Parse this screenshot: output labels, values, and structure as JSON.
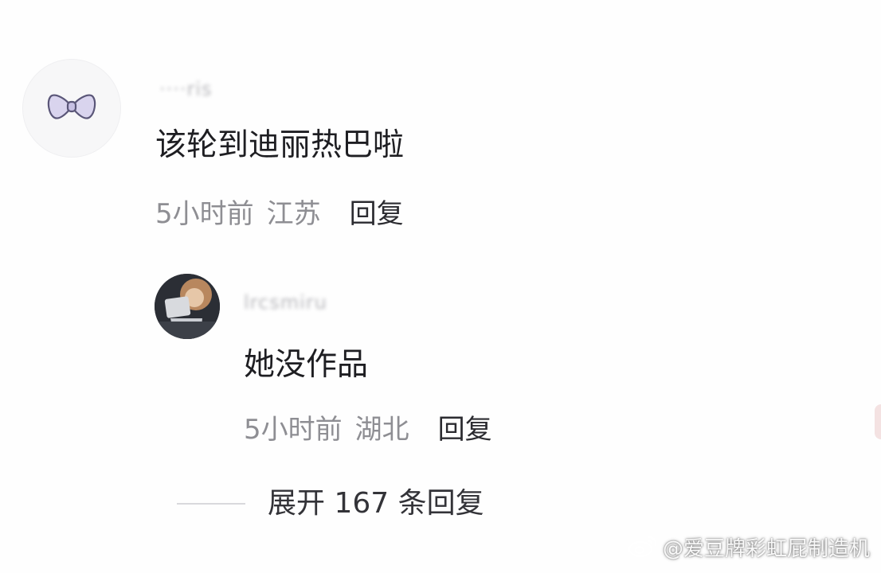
{
  "comments": [
    {
      "username": "····ris",
      "text": "该轮到迪丽热巴啦",
      "time": "5小时前",
      "location": "江苏",
      "reply_label": "回复",
      "avatar_icon": "bow-icon"
    },
    {
      "username": "lrcsmiru",
      "text": "她没作品",
      "time": "5小时前",
      "location": "湖北",
      "reply_label": "回复",
      "avatar_icon": "user-photo"
    }
  ],
  "expand_replies": "展开 167 条回复",
  "watermark": {
    "icon": "weibo-icon",
    "text": "@爱豆牌彩虹屁制造机"
  }
}
